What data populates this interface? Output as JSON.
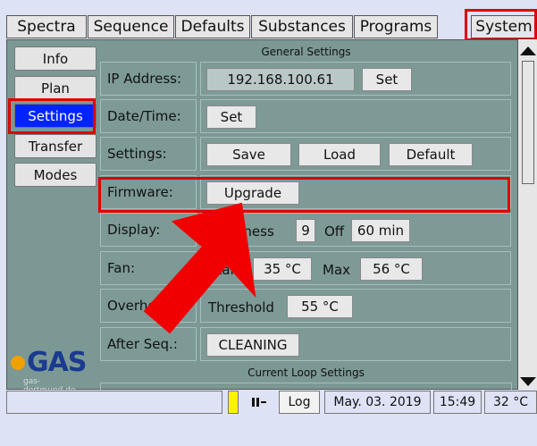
{
  "tabs": [
    "Spectra",
    "Sequence",
    "Defaults",
    "Substances",
    "Programs",
    "System"
  ],
  "sidebar": [
    "Info",
    "Plan",
    "Settings",
    "Transfer",
    "Modes"
  ],
  "section": {
    "general": "General Settings",
    "current": "Current Loop Settings"
  },
  "rows": {
    "ip": {
      "label": "IP Address:",
      "value": "192.168.100.61",
      "button": "Set"
    },
    "datetime": {
      "label": "Date/Time:",
      "button": "Set"
    },
    "settings": {
      "label": "Settings:",
      "save": "Save",
      "load": "Load",
      "default": "Default"
    },
    "firmware": {
      "label": "Firmware:",
      "button": "Upgrade"
    },
    "display": {
      "label": "Display:",
      "brightness_partial": "htness",
      "brightness_value": "9",
      "off_label": "Off",
      "off_value": "60 min"
    },
    "fan": {
      "label": "Fan:",
      "start_partial": "Star",
      "start_value": "35 °C",
      "max_label": "Max",
      "max_value": "56 °C"
    },
    "overheat": {
      "label": "Overheat:",
      "threshold_label": "Threshold",
      "threshold_value": "55 °C"
    },
    "afterseq": {
      "label": "After Seq.:",
      "value": "CLEANING"
    }
  },
  "logo": {
    "text": "GAS",
    "sub": "gas-dortmund.de"
  },
  "status": {
    "log": "Log",
    "date": "May. 03. 2019",
    "time": "15:49",
    "temp": "32 °C"
  },
  "colors": {
    "panel": "#7b9895",
    "active": "#0024ff",
    "highlight": "#e00000",
    "logo": "#1a3b8f",
    "logo_dot": "#f0a000"
  },
  "icons": {
    "up": "triangle-up",
    "down": "triangle-down",
    "battery": "battery-icon",
    "signal": "signal-icon"
  }
}
